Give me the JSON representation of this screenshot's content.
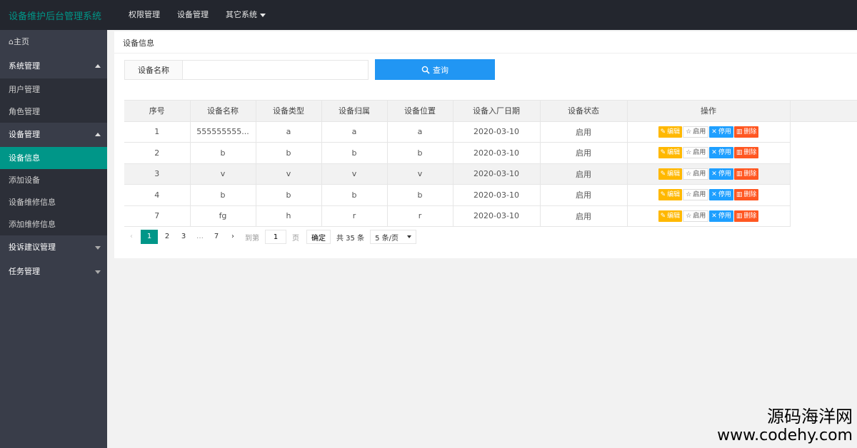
{
  "app": {
    "title": "设备维护后台管理系统"
  },
  "topnav": [
    {
      "label": "权限管理"
    },
    {
      "label": "设备管理"
    },
    {
      "label": "其它系统"
    }
  ],
  "sidebar": {
    "home": "⌂主页",
    "items": [
      {
        "label": "系统管理"
      },
      {
        "label": "用户管理"
      },
      {
        "label": "角色管理"
      },
      {
        "label": "设备管理"
      },
      {
        "label": "设备信息"
      },
      {
        "label": "添加设备"
      },
      {
        "label": "设备维修信息"
      },
      {
        "label": "添加维修信息"
      },
      {
        "label": "投诉建议管理"
      },
      {
        "label": "任务管理"
      }
    ]
  },
  "breadcrumb": "设备信息",
  "search": {
    "label": "设备名称",
    "value": "",
    "placeholder": "",
    "button": "查询"
  },
  "table": {
    "headers": [
      "序号",
      "设备名称",
      "设备类型",
      "设备归属",
      "设备位置",
      "设备入厂日期",
      "设备状态",
      "操作"
    ],
    "rows": [
      [
        "1",
        "555555555...",
        "a",
        "a",
        "a",
        "2020-03-10",
        "启用"
      ],
      [
        "2",
        "b",
        "b",
        "b",
        "b",
        "2020-03-10",
        "启用"
      ],
      [
        "3",
        "v",
        "v",
        "v",
        "v",
        "2020-03-10",
        "启用"
      ],
      [
        "4",
        "b",
        "b",
        "b",
        "b",
        "2020-03-10",
        "启用"
      ],
      [
        "7",
        "fg",
        "h",
        "r",
        "r",
        "2020-03-10",
        "启用"
      ]
    ],
    "actions": {
      "edit": "编辑",
      "enable": "启用",
      "disable": "停用",
      "delete": "删除"
    }
  },
  "pagination": {
    "prev": "‹",
    "pages": [
      "1",
      "2",
      "3",
      "…",
      "7"
    ],
    "next": "›",
    "goto_label": "到第",
    "goto_value": "1",
    "page_unit": "页",
    "confirm": "确定",
    "total": "共 35 条",
    "page_size": "5 条/页"
  },
  "watermark": {
    "cn": "源码海洋网",
    "url": "www.codehy.com"
  },
  "colors": {
    "accent": "#009688",
    "topbar": "#23262e",
    "sidebar": "#393d49",
    "primary_button": "#2196f3"
  }
}
